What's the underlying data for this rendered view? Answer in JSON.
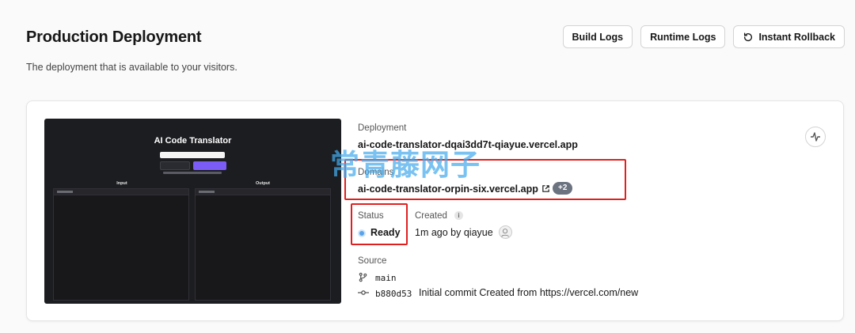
{
  "header": {
    "title": "Production Deployment",
    "subtitle": "The deployment that is available to your visitors.",
    "buttons": {
      "build_logs": "Build Logs",
      "runtime_logs": "Runtime Logs",
      "instant_rollback": "Instant Rollback"
    }
  },
  "preview": {
    "title": "AI Code Translator",
    "input_label": "Input",
    "output_label": "Output"
  },
  "deployment": {
    "label": "Deployment",
    "url": "ai-code-translator-dqai3dd7t-qiayue.vercel.app"
  },
  "domains": {
    "label": "Domains",
    "primary": "ai-code-translator-orpin-six.vercel.app",
    "extra_badge": "+2"
  },
  "status": {
    "label": "Status",
    "value": "Ready",
    "color": "#5aa3e8"
  },
  "created": {
    "label": "Created",
    "value": "1m ago by qiayue"
  },
  "source": {
    "label": "Source",
    "branch": "main",
    "commit_hash": "b880d53",
    "commit_message": "Initial commit Created from https://vercel.com/new"
  },
  "watermark": "常青藤网子",
  "colors": {
    "highlight": "#e0201f",
    "preview_button": "#7c5cf6"
  }
}
